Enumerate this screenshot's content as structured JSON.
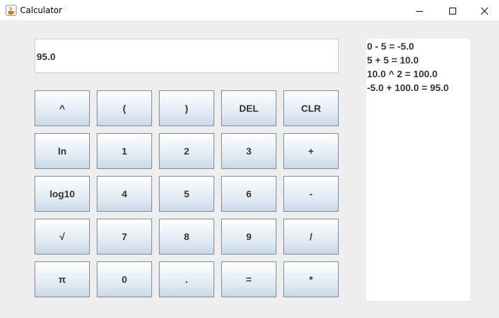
{
  "window": {
    "title": "Calculator",
    "icon": "java-cup-icon"
  },
  "display": {
    "value": "95.0"
  },
  "keys": [
    [
      "^",
      "(",
      ")",
      "DEL",
      "CLR"
    ],
    [
      "ln",
      "1",
      "2",
      "3",
      "+"
    ],
    [
      "log10",
      "4",
      "5",
      "6",
      "-"
    ],
    [
      "√",
      "7",
      "8",
      "9",
      "/"
    ],
    [
      "π",
      "0",
      ".",
      "=",
      "*"
    ]
  ],
  "history": [
    "0 - 5 = -5.0",
    "5 + 5 = 10.0",
    "10.0 ^ 2 = 100.0",
    "-5.0 + 100.0 = 95.0"
  ]
}
